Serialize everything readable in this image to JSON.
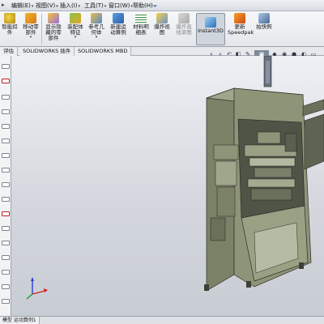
{
  "menubar": {
    "items": [
      {
        "label": "编辑(E)"
      },
      {
        "label": "视图(V)"
      },
      {
        "label": "插入(I)"
      },
      {
        "label": "工具(T)"
      },
      {
        "label": "窗口(W)"
      },
      {
        "label": "帮助(H)"
      }
    ]
  },
  "ribbon": {
    "buttons": [
      {
        "label1": "智能扣",
        "label2": "件"
      },
      {
        "label1": "移动零",
        "label2": "部件"
      },
      {
        "label1": "显示隐",
        "label2": "藏的零",
        "label3": "部件"
      },
      {
        "label1": "装配体",
        "label2": "特征"
      },
      {
        "label1": "参考几",
        "label2": "何体"
      },
      {
        "label1": "新建运",
        "label2": "动算例"
      },
      {
        "label1": "材料明",
        "label2": "细表"
      },
      {
        "label1": "爆炸视",
        "label2": "图"
      },
      {
        "label1": "爆炸直",
        "label2": "线草图"
      },
      {
        "label1": "Instant3D",
        "label2": ""
      },
      {
        "label1": "更新",
        "label2": "Speedpak"
      },
      {
        "label1": "拍快照",
        "label2": ""
      }
    ]
  },
  "tabs": [
    {
      "label": "评估"
    },
    {
      "label": "SOLIDWORKS 插件"
    },
    {
      "label": "SOLIDWORKS MBD"
    }
  ],
  "status": {
    "tab_label": "模型 运动算例1"
  },
  "colors": {
    "machine_body": "#8e9478",
    "machine_dark": "#5f6452",
    "machine_edge": "#2d3028",
    "axis_x": "#d21f1f",
    "axis_y": "#1a9c2a",
    "axis_z": "#2a3fd6"
  }
}
